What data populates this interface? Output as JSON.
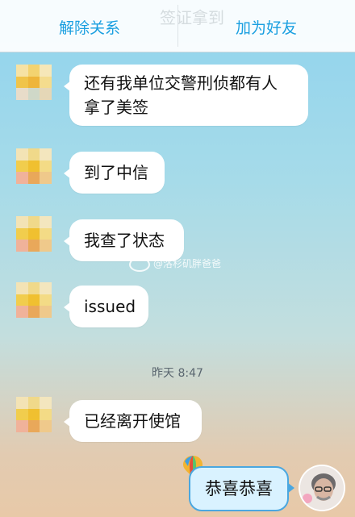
{
  "header": {
    "left_button": "解除关系",
    "right_button": "加为好友",
    "ghost_title": "签证拿到"
  },
  "messages": [
    {
      "side": "left",
      "text_line1": "还有我单位交警刑侦都有人",
      "text_line2": "拿了美签"
    },
    {
      "side": "left",
      "text": "到了中信"
    },
    {
      "side": "left",
      "text": "我查了状态"
    },
    {
      "side": "left",
      "text": "issued"
    },
    {
      "side": "left",
      "text": "已经离开使馆"
    }
  ],
  "timestamp": "昨天 8:47",
  "watermark": "@洛杉矶胖爸爸",
  "my_message": "恭喜恭喜",
  "colors": {
    "accent": "#1a9fe0",
    "bubble": "#ffffff",
    "my_bubble": "#d9f2ff",
    "my_bubble_border": "#4aa7e0"
  },
  "icons": {
    "avatar": "pixelated-avatar",
    "balloon": "hot-air-balloon-icon",
    "self_avatar": "user-photo-avatar"
  }
}
